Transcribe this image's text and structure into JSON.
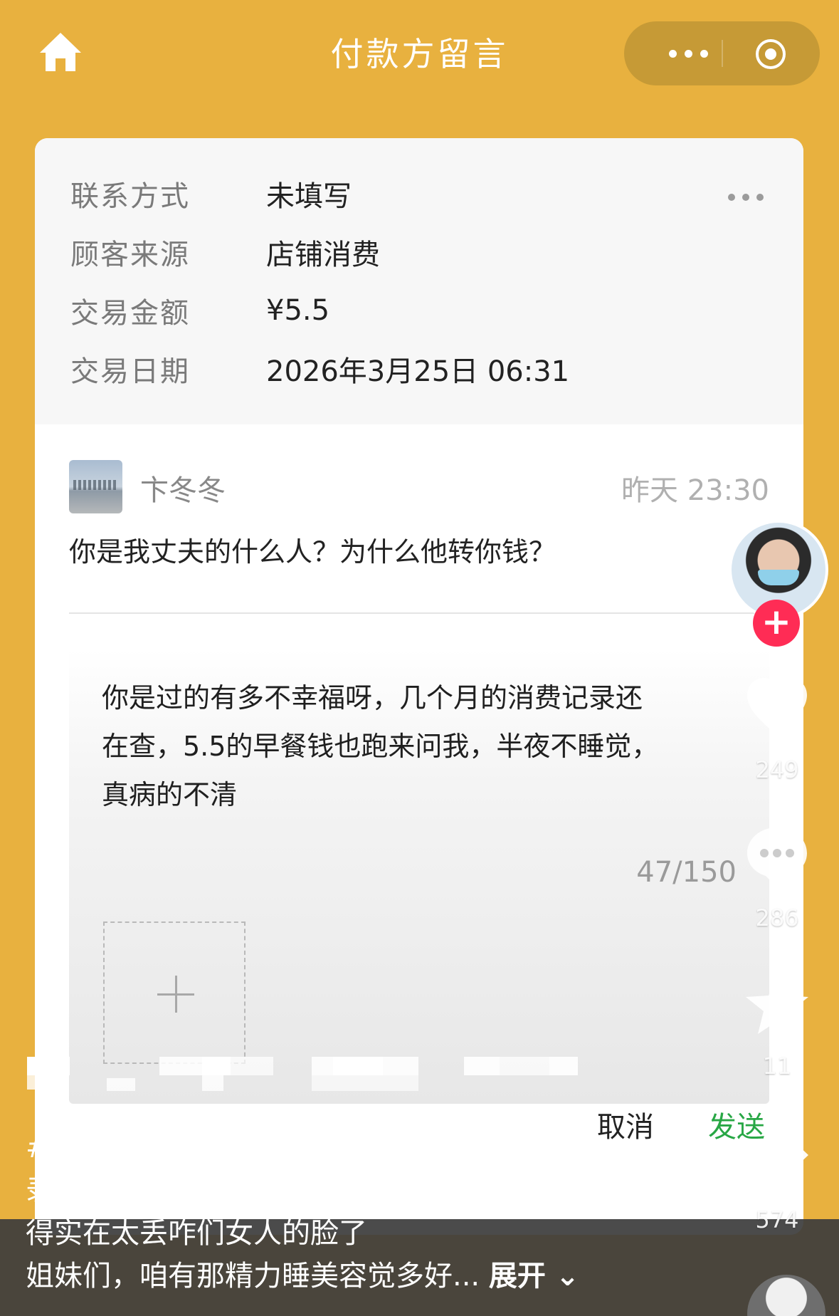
{
  "header": {
    "title": "付款方留言",
    "icons": {
      "home": "home-icon",
      "more": "more-dots-icon",
      "close": "target-close-icon"
    }
  },
  "info": {
    "rows": [
      {
        "label": "联系方式",
        "value": "未填写"
      },
      {
        "label": "顾客来源",
        "value": "店铺消费"
      },
      {
        "label": "交易金额",
        "value": "¥5.5"
      },
      {
        "label": "交易日期",
        "value": "2026年3月25日 06:31"
      }
    ]
  },
  "message": {
    "sender": "卞冬冬",
    "time": "昨天 23:30",
    "text": "你是我丈夫的什么人？为什么他转你钱？"
  },
  "reply": {
    "lines": [
      "你是过的有多不幸福呀，几个月的消费记录还",
      "在查，5.5的早餐钱也跑来问我，半夜不睡觉，",
      "真病的不清"
    ],
    "counter": "47/150"
  },
  "actions": {
    "cancel": "取消",
    "send": "发送"
  },
  "rail": {
    "like_count": "249",
    "comment_count": "286",
    "favorite_count": "11",
    "share_count": "574",
    "follow_symbol": "+"
  },
  "caption": {
    "lines": [
      "###吐槽 大清早看见NaoC女在顾客消费记",
      "录处留言，看了一下，本想小事一桩，可觉",
      "得实在太丢咋们女人的脸了"
    ],
    "last_line": "姐妹们，咱有那精力睡美容觉多好...",
    "expand": "展开"
  },
  "colors": {
    "background": "#e8b13f",
    "capsule": "#c69a36",
    "send": "#28a745",
    "follow": "#ff2c55"
  }
}
